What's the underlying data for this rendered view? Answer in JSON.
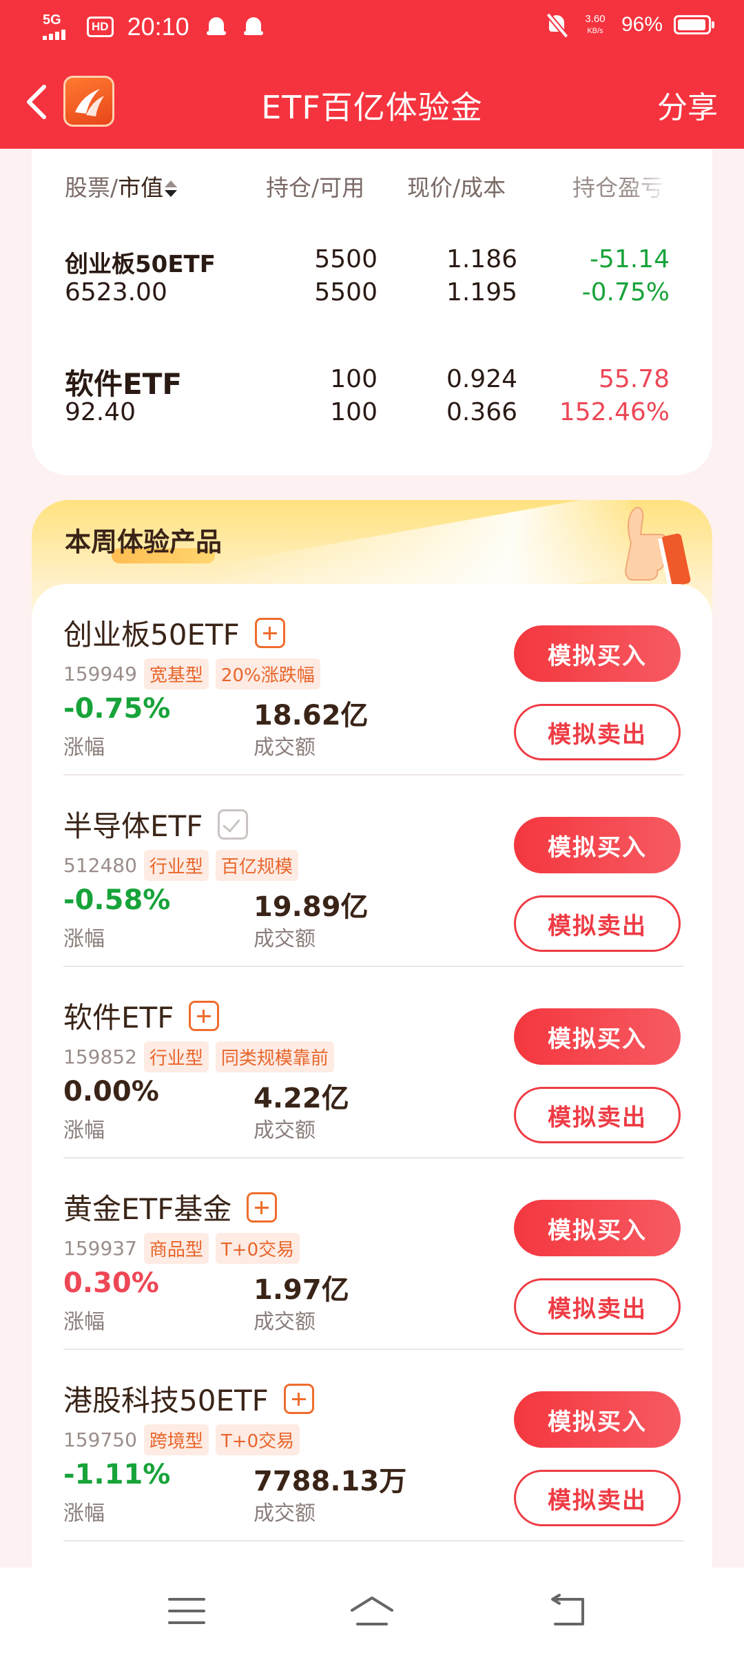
{
  "status_bar": {
    "network": "5G",
    "hd": "HD",
    "time": "20:10",
    "speed_value": "3.60",
    "speed_unit": "KB/s",
    "battery_pct": "96%",
    "battery_level": 0.96
  },
  "header": {
    "title": "ETF百亿体验金",
    "share_label": "分享"
  },
  "holdings": {
    "col_stock": "股票/",
    "col_mv": "市值",
    "col_qty": "持仓/可用",
    "col_price": "现价/成本",
    "col_pl": "持仓盈亏",
    "rows": [
      {
        "name": "创业板50ETF",
        "market_value": "6523.00",
        "qty": "5500",
        "avail": "5500",
        "price": "1.186",
        "cost": "1.195",
        "pl": "-51.14",
        "pl_pct": "-0.75%"
      },
      {
        "name": "软件ETF",
        "market_value": "92.40",
        "qty": "100",
        "avail": "100",
        "price": "0.924",
        "cost": "0.366",
        "pl": "55.78",
        "pl_pct": "152.46%"
      }
    ]
  },
  "products": {
    "title": "本周体验产品",
    "buy_label": "模拟买入",
    "sell_label": "模拟卖出",
    "change_label": "涨幅",
    "volume_label": "成交额",
    "items": [
      {
        "name": "创业板50ETF",
        "code": "159949",
        "tags": [
          "宽基型",
          "20%涨跌幅"
        ],
        "change": "-0.75%",
        "volume": "18.62亿",
        "added": false
      },
      {
        "name": "半导体ETF",
        "code": "512480",
        "tags": [
          "行业型",
          "百亿规模"
        ],
        "change": "-0.58%",
        "volume": "19.89亿",
        "added": true
      },
      {
        "name": "软件ETF",
        "code": "159852",
        "tags": [
          "行业型",
          "同类规模靠前"
        ],
        "change": "0.00%",
        "volume": "4.22亿",
        "added": false
      },
      {
        "name": "黄金ETF基金",
        "code": "159937",
        "tags": [
          "商品型",
          "T+0交易"
        ],
        "change": "0.30%",
        "volume": "1.97亿",
        "added": false
      },
      {
        "name": "港股科技50ETF",
        "code": "159750",
        "tags": [
          "跨境型",
          "T+0交易"
        ],
        "change": "-1.11%",
        "volume": "7788.13万",
        "added": false
      }
    ]
  },
  "colors": {
    "brand_red": "#f5333e",
    "gain_red": "#ee4756",
    "loss_green": "#17a33a",
    "tag_orange": "#e8652a"
  }
}
